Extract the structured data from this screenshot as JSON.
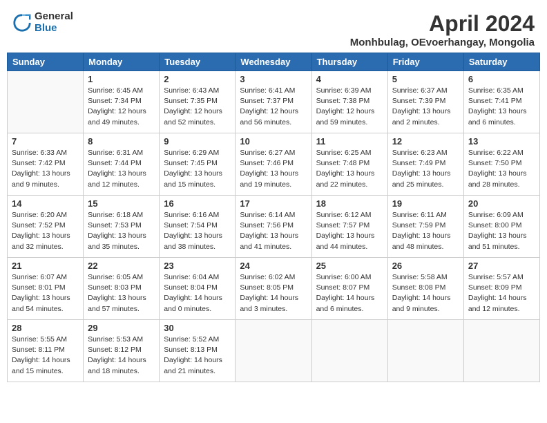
{
  "logo": {
    "general": "General",
    "blue": "Blue"
  },
  "title": "April 2024",
  "location": "Monhbulag, OEvoerhangay, Mongolia",
  "weekdays": [
    "Sunday",
    "Monday",
    "Tuesday",
    "Wednesday",
    "Thursday",
    "Friday",
    "Saturday"
  ],
  "weeks": [
    [
      {
        "day": "",
        "info": ""
      },
      {
        "day": "1",
        "info": "Sunrise: 6:45 AM\nSunset: 7:34 PM\nDaylight: 12 hours\nand 49 minutes."
      },
      {
        "day": "2",
        "info": "Sunrise: 6:43 AM\nSunset: 7:35 PM\nDaylight: 12 hours\nand 52 minutes."
      },
      {
        "day": "3",
        "info": "Sunrise: 6:41 AM\nSunset: 7:37 PM\nDaylight: 12 hours\nand 56 minutes."
      },
      {
        "day": "4",
        "info": "Sunrise: 6:39 AM\nSunset: 7:38 PM\nDaylight: 12 hours\nand 59 minutes."
      },
      {
        "day": "5",
        "info": "Sunrise: 6:37 AM\nSunset: 7:39 PM\nDaylight: 13 hours\nand 2 minutes."
      },
      {
        "day": "6",
        "info": "Sunrise: 6:35 AM\nSunset: 7:41 PM\nDaylight: 13 hours\nand 6 minutes."
      }
    ],
    [
      {
        "day": "7",
        "info": "Sunrise: 6:33 AM\nSunset: 7:42 PM\nDaylight: 13 hours\nand 9 minutes."
      },
      {
        "day": "8",
        "info": "Sunrise: 6:31 AM\nSunset: 7:44 PM\nDaylight: 13 hours\nand 12 minutes."
      },
      {
        "day": "9",
        "info": "Sunrise: 6:29 AM\nSunset: 7:45 PM\nDaylight: 13 hours\nand 15 minutes."
      },
      {
        "day": "10",
        "info": "Sunrise: 6:27 AM\nSunset: 7:46 PM\nDaylight: 13 hours\nand 19 minutes."
      },
      {
        "day": "11",
        "info": "Sunrise: 6:25 AM\nSunset: 7:48 PM\nDaylight: 13 hours\nand 22 minutes."
      },
      {
        "day": "12",
        "info": "Sunrise: 6:23 AM\nSunset: 7:49 PM\nDaylight: 13 hours\nand 25 minutes."
      },
      {
        "day": "13",
        "info": "Sunrise: 6:22 AM\nSunset: 7:50 PM\nDaylight: 13 hours\nand 28 minutes."
      }
    ],
    [
      {
        "day": "14",
        "info": "Sunrise: 6:20 AM\nSunset: 7:52 PM\nDaylight: 13 hours\nand 32 minutes."
      },
      {
        "day": "15",
        "info": "Sunrise: 6:18 AM\nSunset: 7:53 PM\nDaylight: 13 hours\nand 35 minutes."
      },
      {
        "day": "16",
        "info": "Sunrise: 6:16 AM\nSunset: 7:54 PM\nDaylight: 13 hours\nand 38 minutes."
      },
      {
        "day": "17",
        "info": "Sunrise: 6:14 AM\nSunset: 7:56 PM\nDaylight: 13 hours\nand 41 minutes."
      },
      {
        "day": "18",
        "info": "Sunrise: 6:12 AM\nSunset: 7:57 PM\nDaylight: 13 hours\nand 44 minutes."
      },
      {
        "day": "19",
        "info": "Sunrise: 6:11 AM\nSunset: 7:59 PM\nDaylight: 13 hours\nand 48 minutes."
      },
      {
        "day": "20",
        "info": "Sunrise: 6:09 AM\nSunset: 8:00 PM\nDaylight: 13 hours\nand 51 minutes."
      }
    ],
    [
      {
        "day": "21",
        "info": "Sunrise: 6:07 AM\nSunset: 8:01 PM\nDaylight: 13 hours\nand 54 minutes."
      },
      {
        "day": "22",
        "info": "Sunrise: 6:05 AM\nSunset: 8:03 PM\nDaylight: 13 hours\nand 57 minutes."
      },
      {
        "day": "23",
        "info": "Sunrise: 6:04 AM\nSunset: 8:04 PM\nDaylight: 14 hours\nand 0 minutes."
      },
      {
        "day": "24",
        "info": "Sunrise: 6:02 AM\nSunset: 8:05 PM\nDaylight: 14 hours\nand 3 minutes."
      },
      {
        "day": "25",
        "info": "Sunrise: 6:00 AM\nSunset: 8:07 PM\nDaylight: 14 hours\nand 6 minutes."
      },
      {
        "day": "26",
        "info": "Sunrise: 5:58 AM\nSunset: 8:08 PM\nDaylight: 14 hours\nand 9 minutes."
      },
      {
        "day": "27",
        "info": "Sunrise: 5:57 AM\nSunset: 8:09 PM\nDaylight: 14 hours\nand 12 minutes."
      }
    ],
    [
      {
        "day": "28",
        "info": "Sunrise: 5:55 AM\nSunset: 8:11 PM\nDaylight: 14 hours\nand 15 minutes."
      },
      {
        "day": "29",
        "info": "Sunrise: 5:53 AM\nSunset: 8:12 PM\nDaylight: 14 hours\nand 18 minutes."
      },
      {
        "day": "30",
        "info": "Sunrise: 5:52 AM\nSunset: 8:13 PM\nDaylight: 14 hours\nand 21 minutes."
      },
      {
        "day": "",
        "info": ""
      },
      {
        "day": "",
        "info": ""
      },
      {
        "day": "",
        "info": ""
      },
      {
        "day": "",
        "info": ""
      }
    ]
  ]
}
